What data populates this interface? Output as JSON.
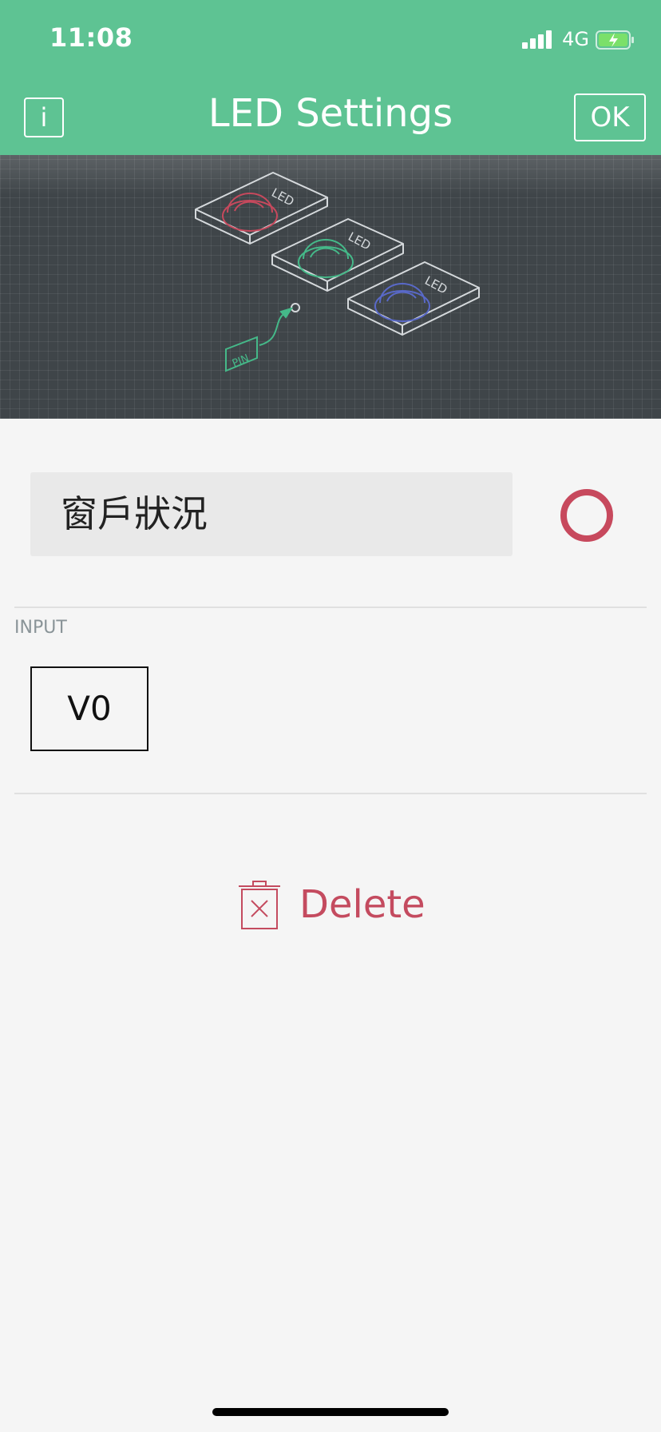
{
  "status_bar": {
    "time": "11:08",
    "network": "4G",
    "signal_bars": 4,
    "battery_state": "charging"
  },
  "nav": {
    "info_label": "i",
    "title": "LED Settings",
    "ok_label": "OK"
  },
  "hero": {
    "led_label": "LED",
    "pin_label": "PIN",
    "led_colors": [
      "#c7495d",
      "#45b989",
      "#5969c9"
    ]
  },
  "form": {
    "name_value": "窗戶狀況",
    "color": "#c7495d",
    "input_label": "INPUT",
    "pin_value": "V0"
  },
  "actions": {
    "delete_label": "Delete"
  },
  "colors": {
    "brand": "#5ec393",
    "danger": "#c44b5f"
  }
}
